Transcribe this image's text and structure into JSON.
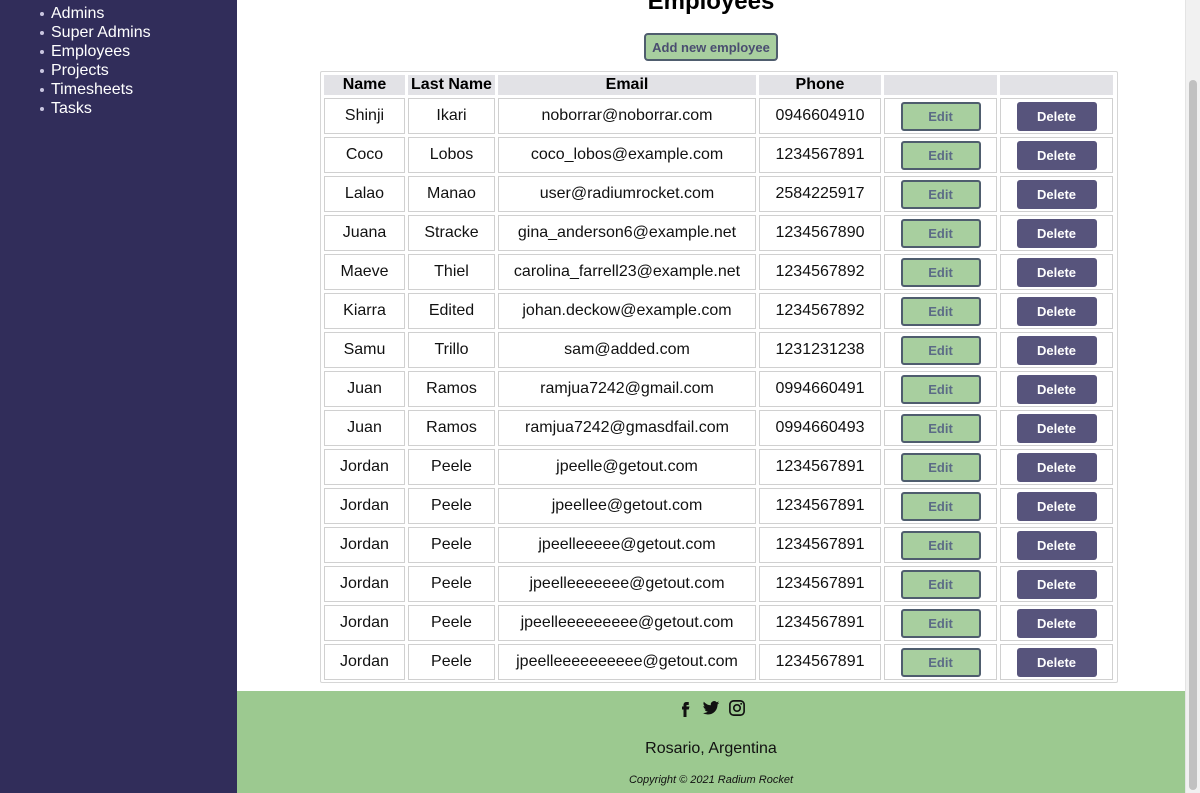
{
  "sidebar": {
    "items": [
      {
        "label": "Admins"
      },
      {
        "label": "Super Admins"
      },
      {
        "label": "Employees"
      },
      {
        "label": "Projects"
      },
      {
        "label": "Timesheets"
      },
      {
        "label": "Tasks"
      }
    ]
  },
  "main": {
    "title": "Employees",
    "add_button_label": "Add new employee",
    "table": {
      "headers": [
        "Name",
        "Last Name",
        "Email",
        "Phone",
        "",
        ""
      ],
      "edit_label": "Edit",
      "delete_label": "Delete",
      "rows": [
        {
          "name": "Shinji",
          "last_name": "Ikari",
          "email": "noborrar@noborrar.com",
          "phone": "0946604910"
        },
        {
          "name": "Coco",
          "last_name": "Lobos",
          "email": "coco_lobos@example.com",
          "phone": "1234567891"
        },
        {
          "name": "Lalao",
          "last_name": "Manao",
          "email": "user@radiumrocket.com",
          "phone": "2584225917"
        },
        {
          "name": "Juana",
          "last_name": "Stracke",
          "email": "gina_anderson6@example.net",
          "phone": "1234567890"
        },
        {
          "name": "Maeve",
          "last_name": "Thiel",
          "email": "carolina_farrell23@example.net",
          "phone": "1234567892"
        },
        {
          "name": "Kiarra",
          "last_name": "Edited",
          "email": "johan.deckow@example.com",
          "phone": "1234567892"
        },
        {
          "name": "Samu",
          "last_name": "Trillo",
          "email": "sam@added.com",
          "phone": "1231231238"
        },
        {
          "name": "Juan",
          "last_name": "Ramos",
          "email": "ramjua7242@gmail.com",
          "phone": "0994660491"
        },
        {
          "name": "Juan",
          "last_name": "Ramos",
          "email": "ramjua7242@gmasdfail.com",
          "phone": "0994660493"
        },
        {
          "name": "Jordan",
          "last_name": "Peele",
          "email": "jpeelle@getout.com",
          "phone": "1234567891"
        },
        {
          "name": "Jordan",
          "last_name": "Peele",
          "email": "jpeellee@getout.com",
          "phone": "1234567891"
        },
        {
          "name": "Jordan",
          "last_name": "Peele",
          "email": "jpeelleeeee@getout.com",
          "phone": "1234567891"
        },
        {
          "name": "Jordan",
          "last_name": "Peele",
          "email": "jpeelleeeeeee@getout.com",
          "phone": "1234567891"
        },
        {
          "name": "Jordan",
          "last_name": "Peele",
          "email": "jpeelleeeeeeeee@getout.com",
          "phone": "1234567891"
        },
        {
          "name": "Jordan",
          "last_name": "Peele",
          "email": "jpeelleeeeeeeeee@getout.com",
          "phone": "1234567891"
        }
      ]
    }
  },
  "footer": {
    "social_icons": [
      "facebook-icon",
      "twitter-icon",
      "instagram-icon"
    ],
    "location": "Rosario, Argentina",
    "copyright": "Copyright © 2021 Radium Rocket"
  },
  "colors": {
    "sidebar_bg": "#312d5a",
    "accent_green": "#a8cf9f",
    "footer_green": "#9cc990",
    "delete_purple": "#57547c"
  }
}
